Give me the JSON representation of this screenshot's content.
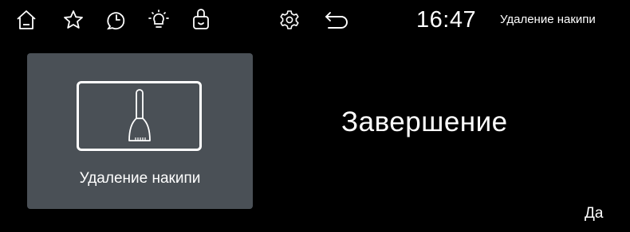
{
  "topbar": {
    "icons": [
      "home-icon",
      "star-icon",
      "clock-icon",
      "bulb-icon",
      "gift-icon",
      "gear-icon",
      "back-arrow-icon"
    ],
    "time": "16:47",
    "screen_title": "Удаление накипи"
  },
  "program_card": {
    "icon": "brush-icon",
    "label": "Удаление накипи"
  },
  "status_text": "Завершение",
  "confirm_label": "Да",
  "colors": {
    "background": "#000000",
    "card": "#4a5056",
    "text": "#ffffff"
  }
}
